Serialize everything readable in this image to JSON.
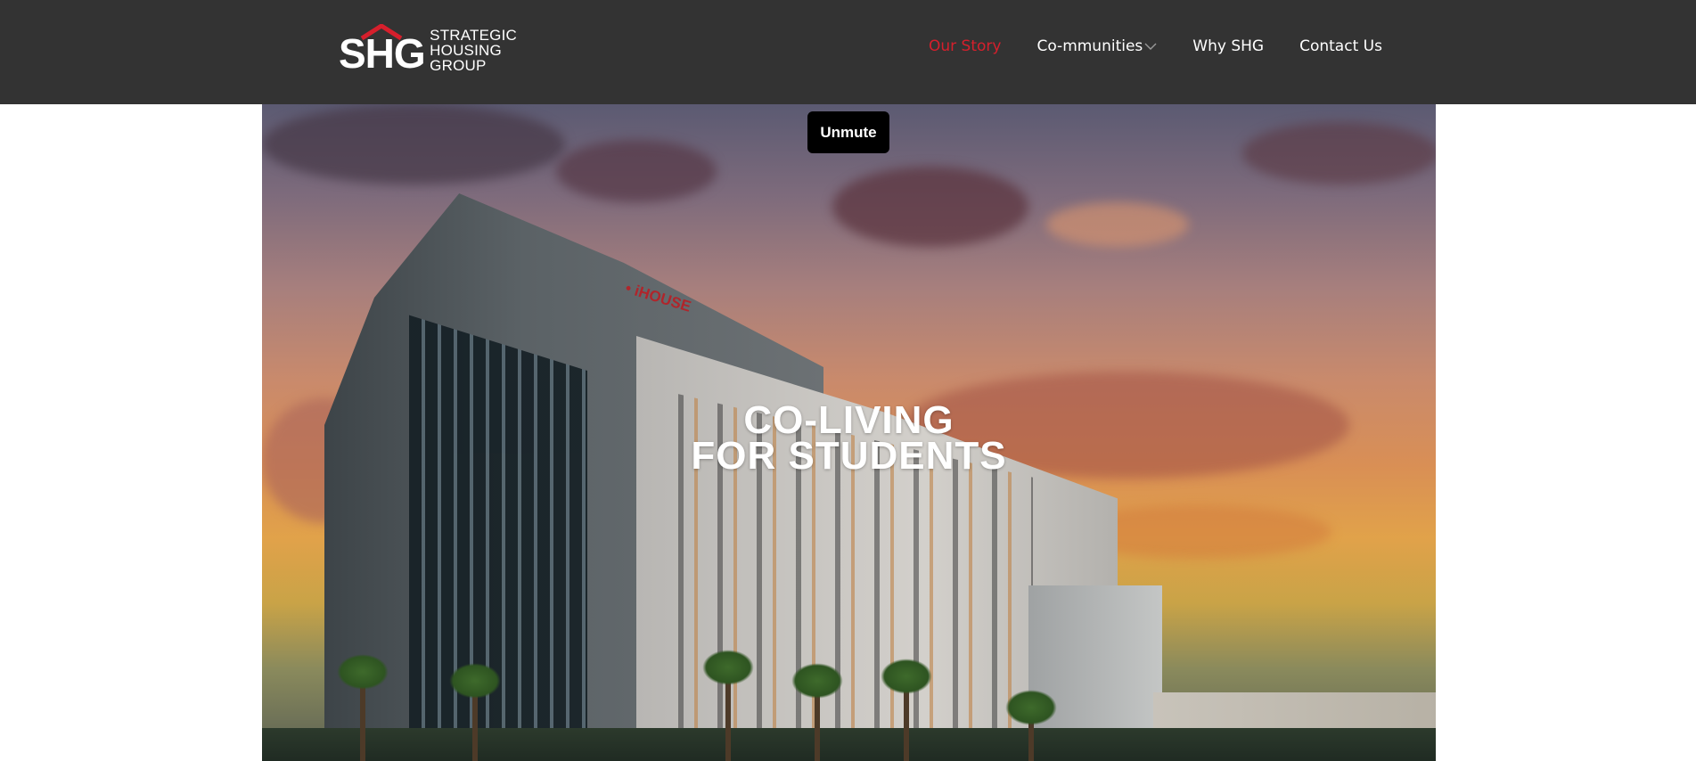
{
  "brand": {
    "initials": "SHG",
    "name_lines": [
      "STRATEGIC",
      "HOUSING",
      "GROUP"
    ],
    "accent_color": "#d61f2c"
  },
  "nav": {
    "items": [
      {
        "label": "Our Story",
        "active": true
      },
      {
        "label": "Co-mmunities",
        "has_dropdown": true
      },
      {
        "label": "Why SHG"
      },
      {
        "label": "Contact Us"
      }
    ]
  },
  "video": {
    "unmute_label": "Unmute"
  },
  "hero": {
    "headline_lines": [
      "CO-LIVING",
      "FOR STUDENTS"
    ],
    "building_sign": "• iHOUSE"
  },
  "colors": {
    "header_bg": "#333333",
    "active_link": "#d61f2c",
    "button_bg": "#000000"
  }
}
